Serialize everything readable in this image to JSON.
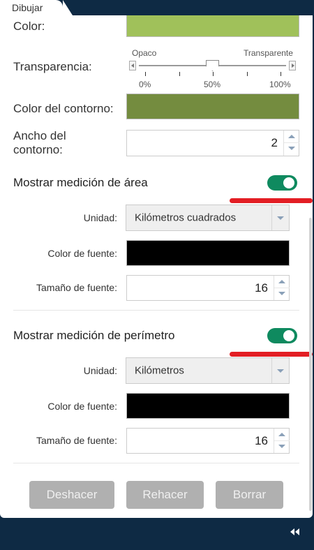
{
  "tab": {
    "label": "Dibujar"
  },
  "fill": {
    "label": "Color:",
    "color": "#a0c15a"
  },
  "transparency": {
    "label": "Transparencia:",
    "min_label": "Opaco",
    "max_label": "Transparente",
    "ticks": [
      "0%",
      "50%",
      "100%"
    ],
    "value": 0.5
  },
  "outline": {
    "color_label": "Color del contorno:",
    "color": "#748c3f",
    "width_label_1": "Ancho del",
    "width_label_2": "contorno:",
    "width_value": "2"
  },
  "area": {
    "title": "Mostrar medición de área",
    "enabled": true,
    "unit_label": "Unidad:",
    "unit_value": "Kilómetros cuadrados",
    "font_color_label": "Color de fuente:",
    "font_color": "#000000",
    "font_size_label": "Tamaño de fuente:",
    "font_size_value": "16"
  },
  "perimeter": {
    "title": "Mostrar medición de perímetro",
    "enabled": true,
    "unit_label": "Unidad:",
    "unit_value": "Kilómetros",
    "font_color_label": "Color de fuente:",
    "font_color": "#000000",
    "font_size_label": "Tamaño de fuente:",
    "font_size_value": "16"
  },
  "actions": {
    "undo": "Deshacer",
    "redo": "Rehacer",
    "clear": "Borrar"
  },
  "colors": {
    "toggle_on": "#0f8a5f",
    "annotation": "#e31e24",
    "chrome": "#0e2a44",
    "button_disabled": "#b0b0b0"
  }
}
